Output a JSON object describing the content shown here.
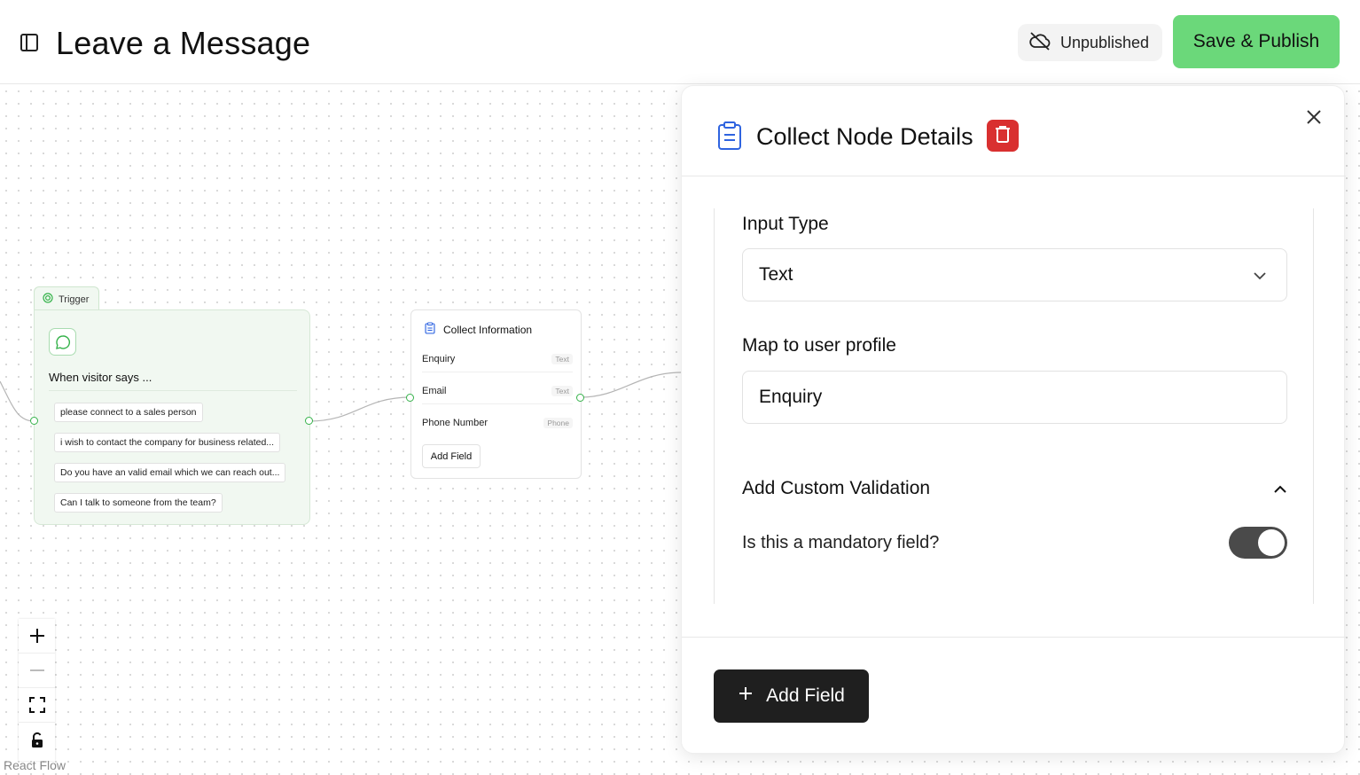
{
  "header": {
    "title": "Leave a Message",
    "status_label": "Unpublished",
    "publish_label": "Save & Publish",
    "publish_color": "#6bd87a"
  },
  "canvas": {
    "trigger_node": {
      "tab_label": "Trigger",
      "heading": "When visitor says ...",
      "phrases": [
        "please connect to a sales person",
        "i wish to contact the company for business related...",
        "Do you have an valid email which we can reach out...",
        "Can I talk to someone from the team?"
      ]
    },
    "collect_node": {
      "title": "Collect Information",
      "fields": [
        {
          "name": "Enquiry",
          "type": "Text"
        },
        {
          "name": "Email",
          "type": "Text"
        },
        {
          "name": "Phone Number",
          "type": "Phone"
        }
      ],
      "add_field_label": "Add Field"
    },
    "controls": [
      "zoom-in-icon",
      "zoom-out-icon",
      "fit-view-icon",
      "lock-icon"
    ],
    "attribution": "React Flow"
  },
  "panel": {
    "title": "Collect Node Details",
    "delete_color": "#d93030",
    "input_type_label": "Input Type",
    "input_type_value": "Text",
    "map_label": "Map to user profile",
    "map_value": "Enquiry",
    "validation_label": "Add Custom Validation",
    "mandatory_label": "Is this a mandatory field?",
    "mandatory_on": true,
    "add_field_label": "Add Field"
  }
}
